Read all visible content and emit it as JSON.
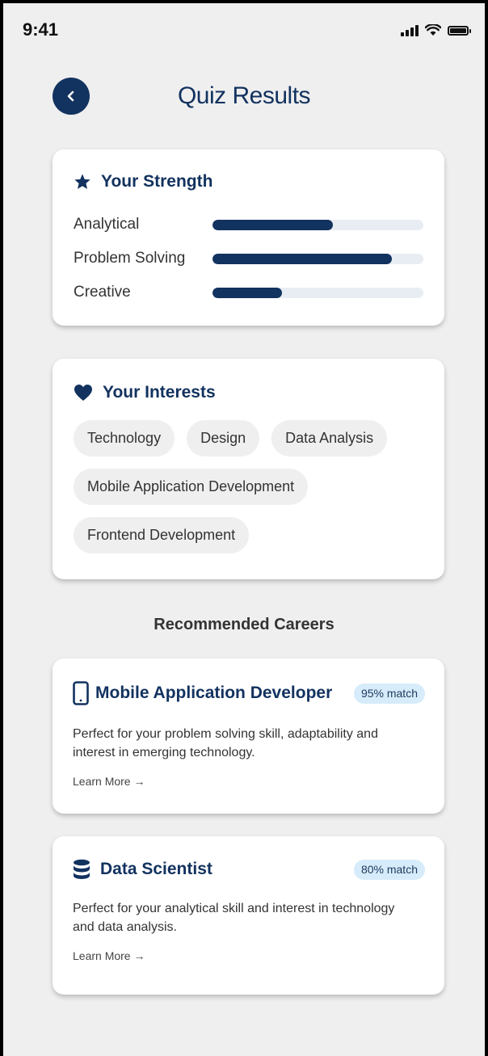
{
  "status_bar": {
    "time": "9:41"
  },
  "header": {
    "title": "Quiz Results"
  },
  "strength": {
    "title": "Your Strength",
    "items": [
      {
        "label": "Analytical",
        "level": 0.57
      },
      {
        "label": "Problem Solving",
        "level": 0.85
      },
      {
        "label": "Creative",
        "level": 0.33
      }
    ]
  },
  "interests": {
    "title": "Your Interests",
    "tags": [
      "Technology",
      "Design",
      "Data Analysis",
      "Mobile Application Development",
      "Frontend Development"
    ]
  },
  "recommended": {
    "heading": "Recommended Careers",
    "careers": [
      {
        "title": "Mobile Application Developer",
        "icon": "smartphone-icon",
        "match": "95% match",
        "description": "Perfect for your problem solving skill, adaptability and interest in emerging technology.",
        "link": "Learn More →"
      },
      {
        "title": "Data Scientist",
        "icon": "database-icon",
        "match": "80% match",
        "description": "Perfect for your analytical skill and interest in technology and data analysis.",
        "link": "Learn More →"
      }
    ]
  },
  "colors": {
    "primary": "#12325f",
    "background": "#efefef",
    "track": "#e8edf3",
    "badge": "#d7ecfa"
  }
}
